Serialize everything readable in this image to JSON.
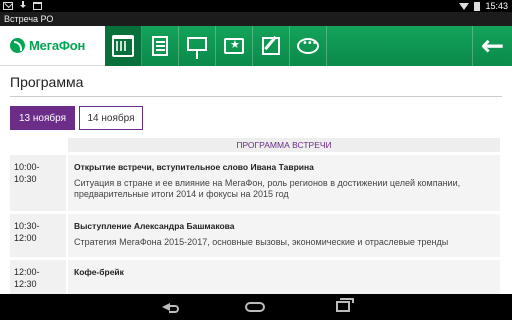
{
  "status_bar": {
    "time": "15:43"
  },
  "window": {
    "title": "Встреча РО"
  },
  "app": {
    "logo_text": "МегаФон",
    "nav": [
      {
        "icon": "calendar-icon"
      },
      {
        "icon": "document-icon"
      },
      {
        "icon": "presentation-icon"
      },
      {
        "icon": "folder-star-icon"
      },
      {
        "icon": "edit-icon"
      },
      {
        "icon": "chat-icon"
      }
    ],
    "back_icon": "back-arrow-icon"
  },
  "page": {
    "title": "Программа",
    "tabs": [
      {
        "label": "13 ноября",
        "active": true
      },
      {
        "label": "14 ноября",
        "active": false
      }
    ],
    "table_header": "ПРОГРАММА ВСТРЕЧИ",
    "rows": [
      {
        "time": "10:00-\n10:30",
        "time_start": "10:00-",
        "time_end": "10:30",
        "title": "Открытие встречи, вступительное слово Ивана Таврина",
        "desc": "Ситуация в стране и ее влияние на МегаФон, роль регионов в достижении целей компании, предварительные итоги 2014 и фокусы на 2015 год"
      },
      {
        "time_start": "10:30-",
        "time_end": "12:00",
        "title": "Выступление Александра Башмакова",
        "desc": "Стратегия МегаФона 2015-2017, основные вызовы, экономические и отраслевые тренды"
      },
      {
        "time_start": "12:00-",
        "time_end": "12:30",
        "title": "Кофе-брейк",
        "desc": ""
      }
    ]
  },
  "colors": {
    "brand_green": "#00a651",
    "toolbar_green": "#0f9d58",
    "accent_purple": "#6b2d87"
  }
}
